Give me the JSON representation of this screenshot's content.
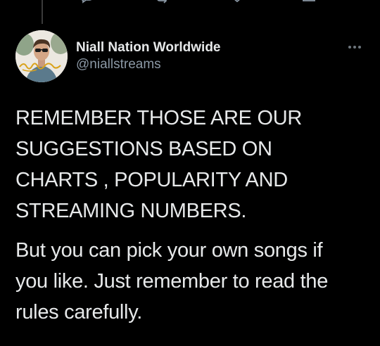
{
  "previous_tweet": {
    "actions": [
      "reply-icon",
      "retweet-icon",
      "like-icon",
      "share-icon"
    ]
  },
  "tweet": {
    "author": {
      "display_name": "Niall Nation Worldwide",
      "handle": "@niallstreams",
      "avatar_signature_text": "Niall Horan"
    },
    "more_icon": "more-options-icon",
    "paragraphs": [
      "REMEMBER THOSE ARE OUR\nSUGGESTIONS BASED ON\nCHARTS , POPULARITY AND\nSTREAMING NUMBERS.",
      "But you can pick your own songs if\nyou like. Just remember to read the\nrules carefully."
    ]
  },
  "colors": {
    "background": "#000000",
    "primary_text": "#e7e9ea",
    "secondary_text": "#8b98a5",
    "avatar_signature": "#d9a21b"
  }
}
